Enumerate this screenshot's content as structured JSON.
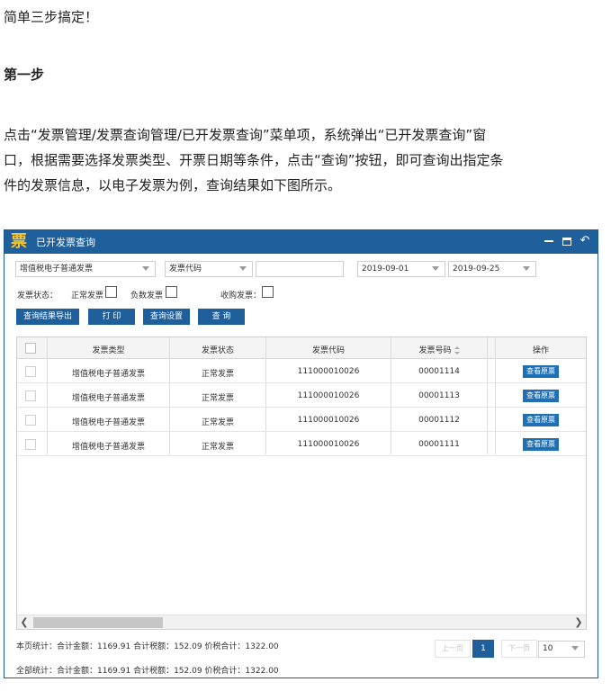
{
  "article": {
    "intro": "简单三步搞定！",
    "step_heading": "第一步",
    "para_line1": "点击“发票管理/发票查询管理/已开发票查询”菜单项，系统弹出“已开发票查询”窗",
    "para_line2": "口，根据需要选择发票类型、开票日期等条件，点击“查询”按钮，即可查询出指定条",
    "para_line3": "件的发票信息，以电子发票为例，查询结果如下图所示。"
  },
  "window": {
    "logo": "票",
    "title": "已开发票查询",
    "colors": {
      "titlebar": "#1f5f9c",
      "logo": "#f7c531",
      "button": "#1f5f9c"
    }
  },
  "filters": {
    "invoice_type": "增值税电子普通发票",
    "code_field": "发票代码",
    "code_value": "",
    "date_from": "2019-09-01",
    "date_to": "2019-09-25"
  },
  "status": {
    "label": "发票状态：",
    "normal": "正常发票",
    "negative": "负数发票",
    "purchase": "收购发票："
  },
  "toolbar": {
    "export": "查询结果导出",
    "print": "打 印",
    "settings": "查询设置",
    "query": "查 询"
  },
  "table": {
    "columns": [
      "发票类型",
      "发票状态",
      "发票代码",
      "发票号码",
      "操作"
    ],
    "rows": [
      {
        "type": "增值税电子普通发票",
        "status": "正常发票",
        "code": "111000010026",
        "number": "00001114",
        "action": "查看原票"
      },
      {
        "type": "增值税电子普通发票",
        "status": "正常发票",
        "code": "111000010026",
        "number": "00001113",
        "action": "查看原票"
      },
      {
        "type": "增值税电子普通发票",
        "status": "正常发票",
        "code": "111000010026",
        "number": "00001112",
        "action": "查看原票"
      },
      {
        "type": "增值税电子普通发票",
        "status": "正常发票",
        "code": "111000010026",
        "number": "00001111",
        "action": "查看原票"
      }
    ]
  },
  "footer": {
    "page_stats": "本页统计：合计金额：1169.91  合计税额：152.09  价税合计：1322.00",
    "all_stats": "全部统计：合计金额：1169.91  合计税额：152.09  价税合计：1322.00",
    "prev": "上一页",
    "current_page": "1",
    "next": "下一页",
    "page_size": "10"
  }
}
